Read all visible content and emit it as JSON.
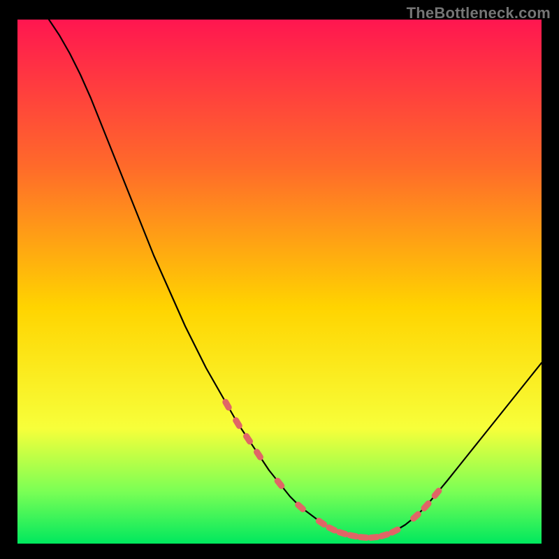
{
  "watermark": "TheBottleneck.com",
  "colors": {
    "gradient_top": "#ff1650",
    "gradient_mid_upper": "#ff6a2a",
    "gradient_mid": "#ffd400",
    "gradient_mid_lower": "#f7ff3a",
    "gradient_green": "#7bff55",
    "gradient_bottom": "#00e85e",
    "curve": "#000000",
    "marker_fill": "#e06666",
    "marker_stroke": "#b34444"
  },
  "chart_data": {
    "type": "line",
    "title": "",
    "xlabel": "",
    "ylabel": "",
    "xlim": [
      0,
      100
    ],
    "ylim": [
      0,
      100
    ],
    "series": [
      {
        "name": "bottleneck-curve",
        "x": [
          6,
          8,
          10,
          12,
          14,
          16,
          18,
          20,
          22,
          24,
          26,
          28,
          30,
          32,
          34,
          36,
          38,
          40,
          42,
          44,
          46,
          48,
          50,
          52,
          54,
          56,
          58,
          60,
          62,
          64,
          66,
          68,
          70,
          72,
          74,
          76,
          78,
          80,
          82,
          84,
          86,
          88,
          90,
          92,
          94,
          96,
          98,
          100
        ],
        "y": [
          100,
          97,
          93.5,
          89.5,
          85,
          80,
          75,
          70,
          65,
          60,
          55,
          50.5,
          46,
          41.5,
          37.5,
          33.5,
          30,
          26.5,
          23,
          20,
          17,
          14,
          11.5,
          9,
          7,
          5.5,
          4,
          2.8,
          2,
          1.5,
          1.2,
          1.2,
          1.6,
          2.4,
          3.6,
          5.2,
          7.2,
          9.6,
          12,
          14.5,
          17,
          19.5,
          22,
          24.5,
          27,
          29.5,
          32,
          34.5
        ]
      }
    ],
    "markers": {
      "name": "highlight-points",
      "x": [
        40,
        42,
        44,
        46,
        50,
        54,
        58,
        60,
        62,
        64,
        66,
        68,
        70,
        72,
        76,
        78,
        80
      ],
      "y": [
        26.5,
        23,
        20,
        17,
        11.5,
        7,
        4,
        2.8,
        2,
        1.5,
        1.2,
        1.2,
        1.6,
        2.4,
        5.2,
        7.2,
        9.6
      ]
    }
  }
}
